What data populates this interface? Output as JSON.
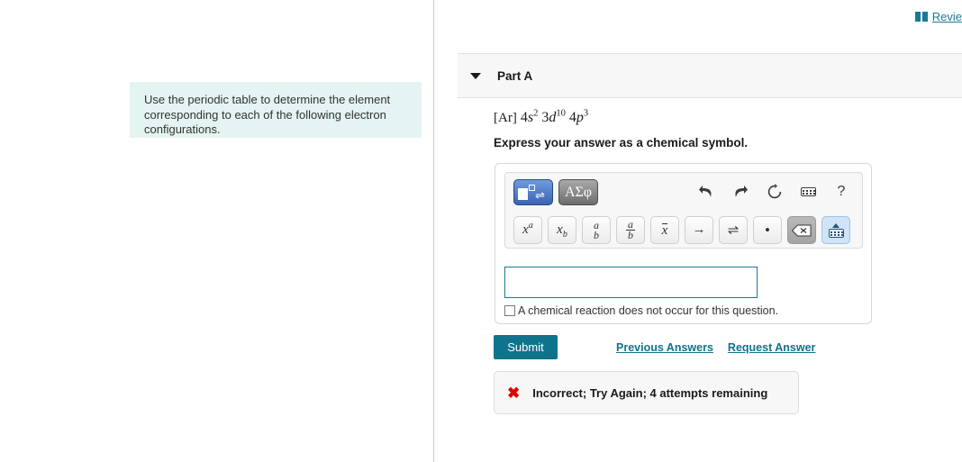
{
  "top": {
    "review_label": "Revie",
    "review_icon": "book-icon"
  },
  "prompt": {
    "text": "Use the periodic table to determine the element corresponding to each of the following electron configurations."
  },
  "part": {
    "title": "Part A",
    "caret_icon": "chevron-down-icon"
  },
  "question": {
    "configuration_plain": "[Ar] 4s2 3d10 4p3",
    "config_bracket": "[Ar]",
    "config_terms": [
      {
        "coef": "4",
        "orbital": "s",
        "exp": "2"
      },
      {
        "coef": "3",
        "orbital": "d",
        "exp": "10"
      },
      {
        "coef": "4",
        "orbital": "p",
        "exp": "3"
      }
    ],
    "instruction": "Express your answer as a chemical symbol."
  },
  "math_toolbar": {
    "template_button": {
      "name": "template-equation-button",
      "state": "selected",
      "color": "#3b63b5"
    },
    "greek_button": {
      "label": "ΑΣφ",
      "name": "greek-symbols-button",
      "color": "#6d6d6d"
    },
    "action_icons": [
      {
        "name": "undo-icon",
        "label": "undo"
      },
      {
        "name": "redo-icon",
        "label": "redo"
      },
      {
        "name": "reset-icon",
        "label": "reset"
      },
      {
        "name": "keyboard-icon",
        "label": "keyboard"
      },
      {
        "name": "help-icon",
        "label": "?"
      }
    ],
    "palette": [
      {
        "name": "superscript-button",
        "base": "x",
        "sup": "a"
      },
      {
        "name": "subscript-button",
        "base": "x",
        "sub": "b"
      },
      {
        "name": "stacked-ab-button",
        "top": "a",
        "bottom": "b"
      },
      {
        "name": "fraction-button",
        "top": "a",
        "bottom": "b"
      },
      {
        "name": "overbar-button",
        "base": "x"
      },
      {
        "name": "right-arrow-button",
        "glyph": "→"
      },
      {
        "name": "equilibrium-arrow-button",
        "glyph": "⇌"
      },
      {
        "name": "dot-button",
        "glyph": "•"
      },
      {
        "name": "backspace-button",
        "glyph": "⌫"
      },
      {
        "name": "keyboard-toggle-button",
        "glyph": "keyboard"
      }
    ]
  },
  "answer": {
    "value": "",
    "placeholder": "",
    "no_reaction_checkbox": {
      "label": "A chemical reaction does not occur for this question.",
      "checked": false
    }
  },
  "actions": {
    "submit_label": "Submit",
    "previous_answers_label": "Previous Answers",
    "request_answer_label": "Request Answer",
    "submit_color": "#10738c"
  },
  "feedback": {
    "icon": "x-mark-icon",
    "text": "Incorrect; Try Again; 4 attempts remaining",
    "icon_color": "#e00000"
  }
}
